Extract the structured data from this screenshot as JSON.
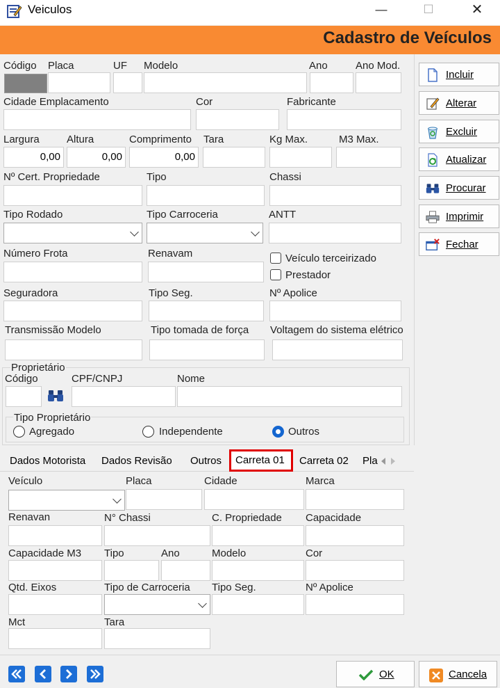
{
  "window": {
    "title": "Veiculos",
    "minimize": "—",
    "maximize": "☐",
    "close": "✕"
  },
  "header": {
    "title": "Cadastro de Veículos"
  },
  "fields": {
    "codigo": "Código",
    "placa": "Placa",
    "uf": "UF",
    "modelo": "Modelo",
    "ano": "Ano",
    "ano_mod": "Ano Mod.",
    "cidade_emplacamento": "Cidade Emplacamento",
    "cor": "Cor",
    "fabricante": "Fabricante",
    "largura": "Largura",
    "altura": "Altura",
    "comprimento": "Comprimento",
    "tara": "Tara",
    "kg_max": "Kg Max.",
    "m3_max": "M3 Max.",
    "largura_value": "0,00",
    "altura_value": "0,00",
    "comprimento_value": "0,00",
    "cert_propriedade": "Nº Cert. Propriedade",
    "tipo": "Tipo",
    "chassi": "Chassi",
    "tipo_rodado": "Tipo Rodado",
    "tipo_carroceria": "Tipo Carroceria",
    "antt": "ANTT",
    "numero_frota": "Número Frota",
    "renavam": "Renavam",
    "veiculo_terceirizado": "Veículo terceirizado",
    "prestador": "Prestador",
    "seguradora": "Seguradora",
    "tipo_seg": "Tipo Seg.",
    "n_apolice": "Nº Apolice",
    "transmissao_modelo": "Transmissão Modelo",
    "tipo_tomada": "Tipo tomada de força",
    "voltagem": "Voltagem do sistema elétrico"
  },
  "proprietario": {
    "group_title": "Proprietário",
    "codigo": "Código",
    "cpf_cnpj": "CPF/CNPJ",
    "nome": "Nome",
    "tipo_title": "Tipo Proprietário",
    "options": [
      "Agregado",
      "Independente",
      "Outros"
    ],
    "selected": "Outros"
  },
  "tabs": [
    "Dados Motorista",
    "Dados Revisão",
    "Outros",
    "Carreta 01",
    "Carreta 02",
    "Pla"
  ],
  "active_tab": "Carreta 01",
  "carreta": {
    "veiculo": "Veículo",
    "placa": "Placa",
    "cidade": "Cidade",
    "marca": "Marca",
    "renavan": "Renavan",
    "n_chassi": "N° Chassi",
    "c_propriedade": "C. Propriedade",
    "capacidade": "Capacidade",
    "capacidade_m3": "Capacidade M3",
    "tipo": "Tipo",
    "ano": "Ano",
    "modelo": "Modelo",
    "cor": "Cor",
    "qtd_eixos": "Qtd. Eixos",
    "tipo_carroceria": "Tipo de Carroceria",
    "tipo_seg": "Tipo Seg.",
    "n_apolice": "Nº Apolice",
    "mct": "Mct",
    "tara": "Tara"
  },
  "side_buttons": [
    {
      "label": "Incluir",
      "icon": "document-new-icon"
    },
    {
      "label": "Alterar",
      "icon": "edit-pencil-icon"
    },
    {
      "label": "Excluir",
      "icon": "trash-recycle-icon"
    },
    {
      "label": "Atualizar",
      "icon": "refresh-icon"
    },
    {
      "label": "Procurar",
      "icon": "binoculars-icon"
    },
    {
      "label": "Imprimir",
      "icon": "printer-icon"
    },
    {
      "label": "Fechar",
      "icon": "close-window-icon"
    }
  ],
  "bottom": {
    "ok": "OK",
    "cancel": "Cancela"
  },
  "colors": {
    "header": "#f98a32",
    "nav": "#1d6ed6",
    "tab_highlight": "#e00000",
    "radio": "#1466d0"
  }
}
